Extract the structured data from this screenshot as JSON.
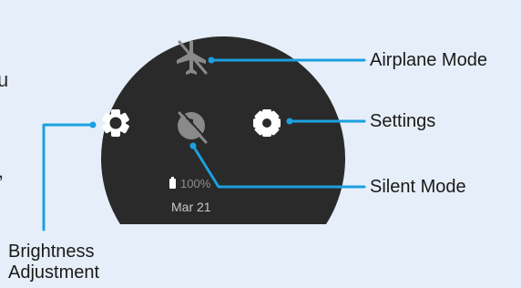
{
  "watch_face": {
    "battery_text": "100%",
    "date_text": "Mar 21",
    "icons": {
      "airplane": "airplane-off-icon",
      "brightness": "brightness-icon",
      "silent": "silent-mode-icon",
      "settings": "gear-icon",
      "battery": "battery-icon"
    }
  },
  "callouts": {
    "airplane_mode": "Airplane Mode",
    "settings": "Settings",
    "silent_mode": "Silent Mode",
    "brightness_line1": "Brightness",
    "brightness_line2": "Adjustment"
  },
  "edge_fragments": {
    "top": "u",
    "middle": ","
  },
  "colors": {
    "background": "#e6eef9",
    "watch_face": "#2a2a2a",
    "icon_white": "#ffffff",
    "icon_gray": "#8a8a8a",
    "callout_line": "#1ca0e0"
  }
}
